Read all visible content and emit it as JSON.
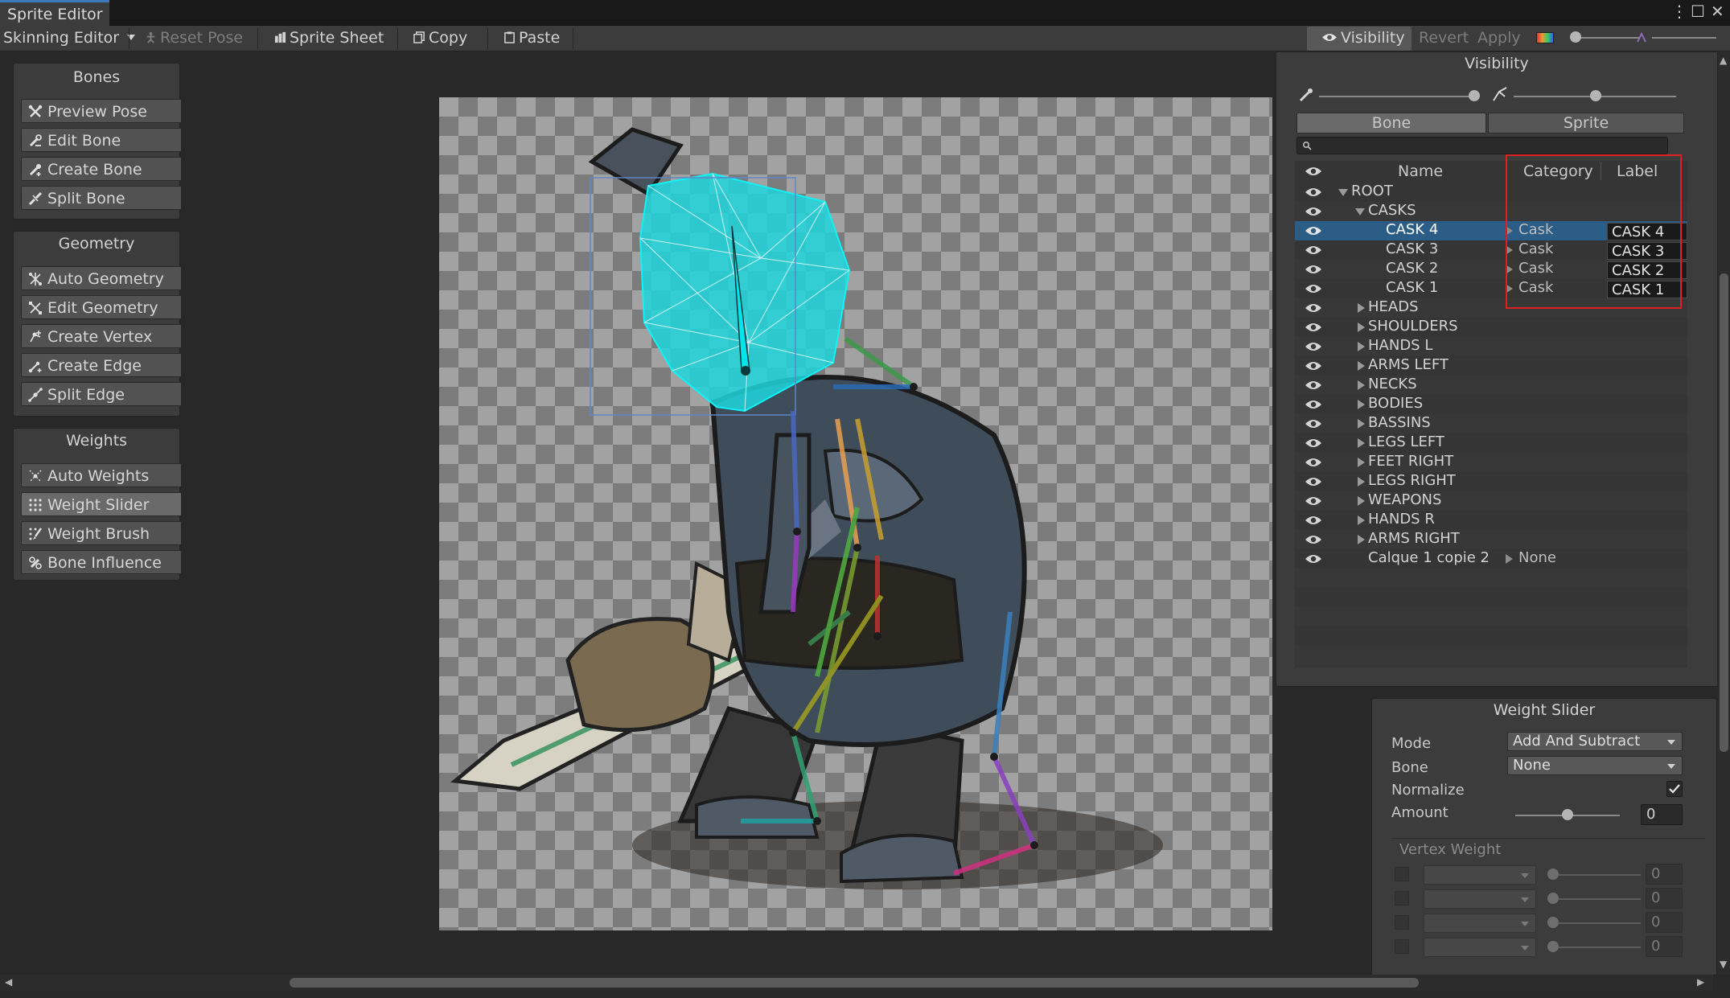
{
  "window": {
    "title": "Sprite Editor",
    "menu_glyph": "⋮",
    "maximize_glyph": "☐",
    "close_glyph": "✕"
  },
  "toolbar": {
    "mode": "Skinning Editor",
    "reset_pose": "Reset Pose",
    "sprite_sheet": "Sprite Sheet",
    "copy": "Copy",
    "paste": "Paste",
    "visibility": "Visibility",
    "revert": "Revert",
    "apply": "Apply"
  },
  "panels": {
    "bones": {
      "title": "Bones",
      "tools": [
        "Preview Pose",
        "Edit Bone",
        "Create Bone",
        "Split Bone"
      ]
    },
    "geometry": {
      "title": "Geometry",
      "tools": [
        "Auto Geometry",
        "Edit Geometry",
        "Create Vertex",
        "Create Edge",
        "Split Edge"
      ]
    },
    "weights": {
      "title": "Weights",
      "tools": [
        "Auto Weights",
        "Weight Slider",
        "Weight Brush",
        "Bone Influence"
      ]
    }
  },
  "visibility": {
    "title": "Visibility",
    "tabs": [
      "Bone",
      "Sprite"
    ],
    "columns": {
      "name": "Name",
      "category": "Category",
      "label": "Label"
    },
    "rows": [
      {
        "name": "ROOT",
        "depth": 0,
        "expand": "down"
      },
      {
        "name": "CASKS",
        "depth": 1,
        "expand": "down"
      },
      {
        "name": "CASK 4",
        "depth": 2,
        "category": "Cask",
        "label": "CASK 4",
        "selected": true
      },
      {
        "name": "CASK 3",
        "depth": 2,
        "category": "Cask",
        "label": "CASK 3"
      },
      {
        "name": "CASK 2",
        "depth": 2,
        "category": "Cask",
        "label": "CASK 2"
      },
      {
        "name": "CASK 1",
        "depth": 2,
        "category": "Cask",
        "label": "CASK 1"
      },
      {
        "name": "HEADS",
        "depth": 1,
        "expand": "right"
      },
      {
        "name": "SHOULDERS",
        "depth": 1,
        "expand": "right"
      },
      {
        "name": "HANDS L",
        "depth": 1,
        "expand": "right"
      },
      {
        "name": "ARMS LEFT",
        "depth": 1,
        "expand": "right"
      },
      {
        "name": "NECKS",
        "depth": 1,
        "expand": "right"
      },
      {
        "name": "BODIES",
        "depth": 1,
        "expand": "right"
      },
      {
        "name": "BASSINS",
        "depth": 1,
        "expand": "right"
      },
      {
        "name": "LEGS LEFT",
        "depth": 1,
        "expand": "right"
      },
      {
        "name": "FEET RIGHT",
        "depth": 1,
        "expand": "right"
      },
      {
        "name": "LEGS RIGHT",
        "depth": 1,
        "expand": "right"
      },
      {
        "name": "WEAPONS",
        "depth": 1,
        "expand": "right"
      },
      {
        "name": "HANDS R",
        "depth": 1,
        "expand": "right"
      },
      {
        "name": "ARMS RIGHT",
        "depth": 1,
        "expand": "right"
      },
      {
        "name": "Calque 1 copie 2",
        "depth": 1,
        "category": "None"
      }
    ]
  },
  "weight_slider": {
    "title": "Weight Slider",
    "mode_label": "Mode",
    "mode_value": "Add And Subtract",
    "bone_label": "Bone",
    "bone_value": "None",
    "normalize_label": "Normalize",
    "normalize_checked": true,
    "amount_label": "Amount",
    "amount_value": "0",
    "amount_fraction": 0.5,
    "vertex_weight_label": "Vertex Weight",
    "vertex_weights": [
      "0",
      "0",
      "0",
      "0"
    ]
  },
  "colors": {
    "accent": "#3a79bb",
    "selection": "#2c5d87",
    "highlight_box": "#e02020",
    "mesh": "#1fd6dd"
  }
}
